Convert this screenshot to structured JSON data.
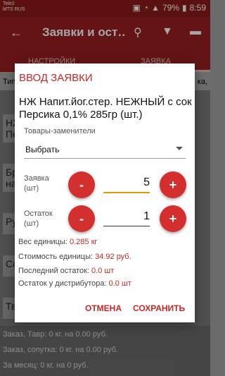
{
  "status": {
    "carrier1": "Tele2",
    "carrier2": "MTS RUS",
    "battery": "79%",
    "time": "8:59"
  },
  "appbar": {
    "title": "Заявки и ост…"
  },
  "tabs": {
    "left": "НАСТРОЙКИ",
    "right": "ЗАЯВКА"
  },
  "list": {
    "header_left": "Тип",
    "header_right": "ка,",
    "rows": [
      "НЖ\nПе",
      "Бр\nна",
      "Ру",
      "Со",
      "Тв"
    ]
  },
  "footer": {
    "line1": "Заказ, Тавр: 0 кг. на 0.00 руб.",
    "line2": "Заказ, сопутка: 0 кг. на 0.00 руб.",
    "line3": "За месяц: 0 кг. на 0 руб."
  },
  "dialog": {
    "title": "ВВОД ЗАЯВКИ",
    "product": "НЖ Напит.йог.стер. НЕЖНЫЙ с сок Персика 0,1% 285гр (шт.)",
    "substitutes_label": "Товары-заменители",
    "select_value": "Выбрать",
    "order_label": "Заявка\n(шт)",
    "order_value": "5",
    "stock_label": "Остаток\n(шт)",
    "stock_value": "1",
    "minus": "-",
    "plus": "+",
    "weight_label": "Вес единицы: ",
    "weight_value": "0.285 кг",
    "cost_label": "Стоимость единицы: ",
    "cost_value": "34.92 руб.",
    "last_stock_label": "Последний остаток: ",
    "last_stock_value": "0.0 шт",
    "dist_stock_label": "Остаток у дистрибутора: ",
    "dist_stock_value": "0.0 шт",
    "cancel": "ОТМЕНА",
    "save": "СОХРАНИТЬ"
  }
}
